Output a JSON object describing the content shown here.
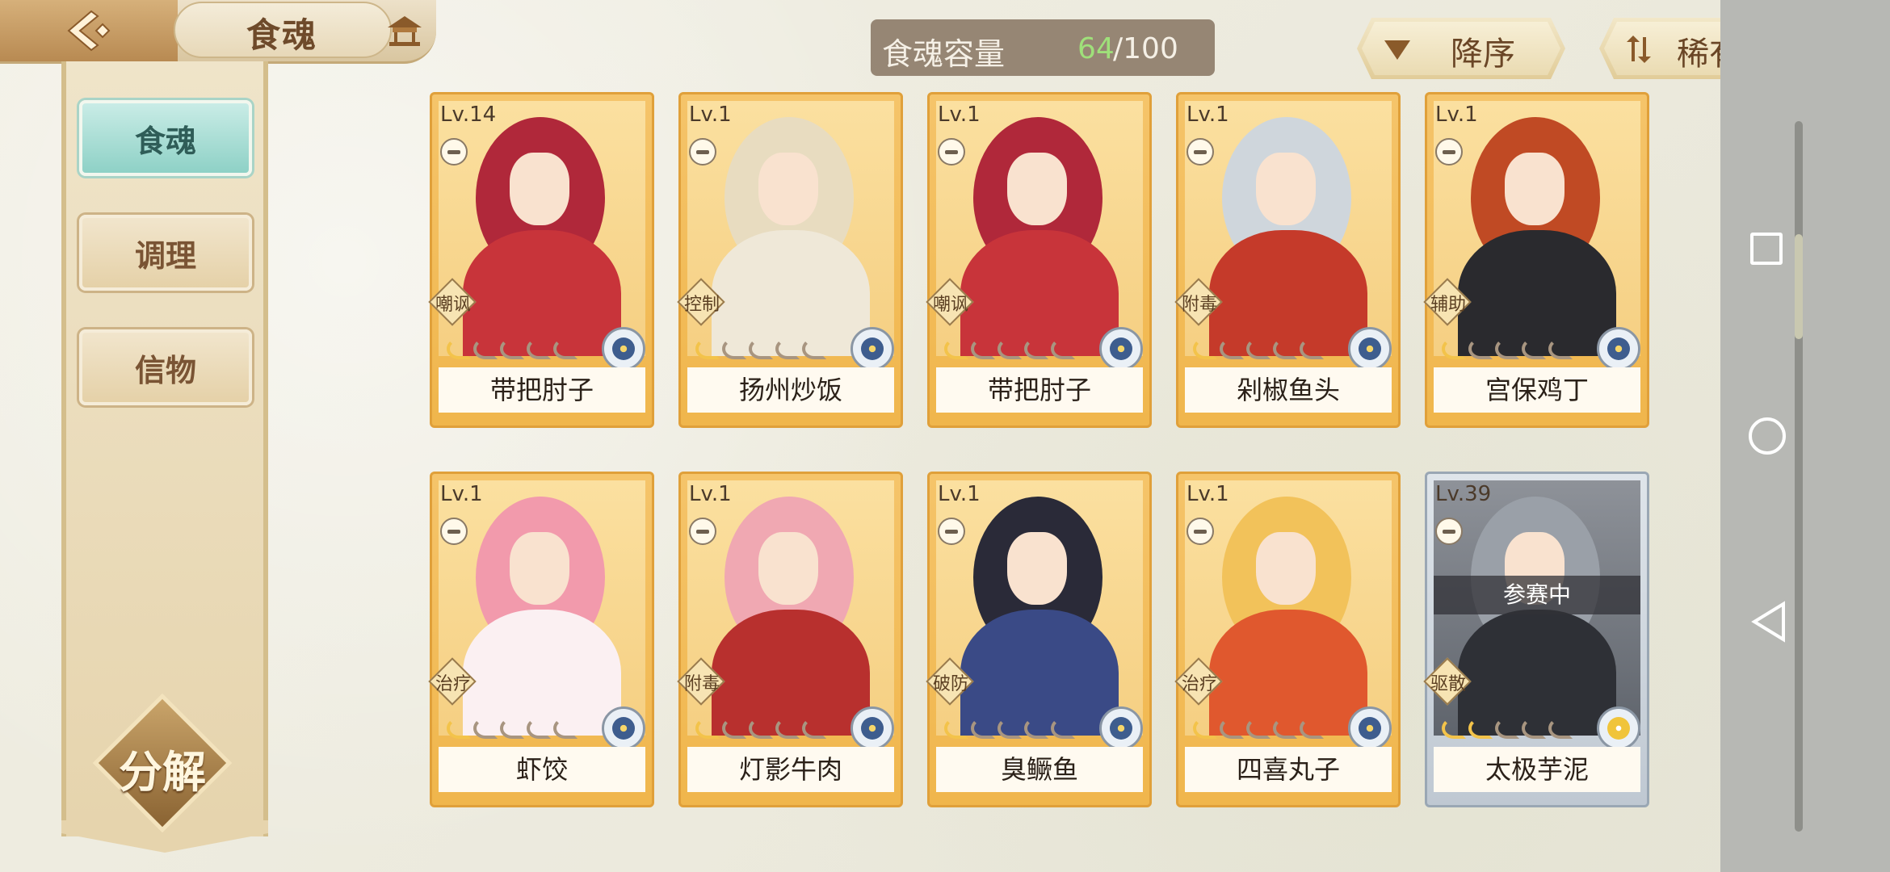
{
  "header": {
    "title": "食魂"
  },
  "capacity": {
    "label": "食魂容量",
    "current": "64",
    "max": "/100"
  },
  "sort": {
    "order_label": "降序",
    "rarity_label": "稀有度"
  },
  "sidebar": {
    "items": [
      {
        "label": "食魂"
      },
      {
        "label": "调理"
      },
      {
        "label": "信物"
      }
    ],
    "decompose_label": "分解"
  },
  "cards": [
    {
      "level": "Lv.14",
      "role": "嘲讽",
      "name": "带把肘子",
      "stars_on": 1,
      "element_icon": "flower-element-icon",
      "frame": "gold"
    },
    {
      "level": "Lv.1",
      "role": "控制",
      "name": "扬州炒饭",
      "stars_on": 1,
      "element_icon": "flower-element-icon",
      "frame": "gold"
    },
    {
      "level": "Lv.1",
      "role": "嘲讽",
      "name": "带把肘子",
      "stars_on": 1,
      "element_icon": "flower-element-icon",
      "frame": "gold"
    },
    {
      "level": "Lv.1",
      "role": "附毒",
      "name": "剁椒鱼头",
      "stars_on": 1,
      "element_icon": "flower-element-icon",
      "frame": "gold"
    },
    {
      "level": "Lv.1",
      "role": "辅助",
      "name": "宫保鸡丁",
      "stars_on": 1,
      "element_icon": "flower-element-icon",
      "frame": "gold"
    },
    {
      "level": "Lv.1",
      "role": "治疗",
      "name": "虾饺",
      "stars_on": 1,
      "element_icon": "flower-element-icon",
      "frame": "gold"
    },
    {
      "level": "Lv.1",
      "role": "附毒",
      "name": "灯影牛肉",
      "stars_on": 1,
      "element_icon": "flower-element-icon",
      "frame": "gold"
    },
    {
      "level": "Lv.1",
      "role": "破防",
      "name": "臭鳜鱼",
      "stars_on": 1,
      "element_icon": "flower-element-icon",
      "frame": "gold"
    },
    {
      "level": "Lv.1",
      "role": "治疗",
      "name": "四喜丸子",
      "stars_on": 1,
      "element_icon": "flower-element-icon",
      "frame": "gold"
    },
    {
      "level": "Lv.39",
      "role": "驱散",
      "name": "太极芋泥",
      "stars_on": 2,
      "element_icon": "gold-flower-element-icon",
      "frame": "silver",
      "badge": "参赛中"
    }
  ],
  "colors": {
    "card_gold": "#f0b64c",
    "card_silver": "#bfc8d2",
    "nav_active": "#8ed1c6",
    "capacity_current": "#9fe07a"
  }
}
